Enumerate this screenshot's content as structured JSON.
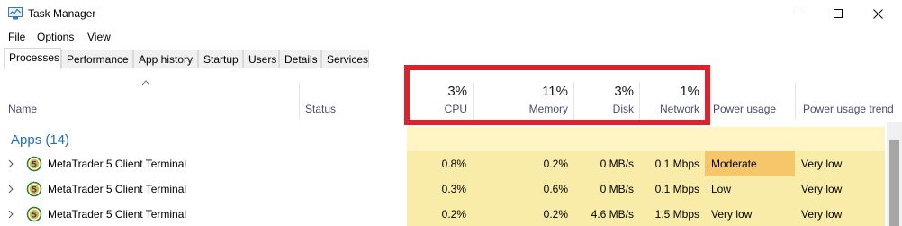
{
  "window": {
    "title": "Task Manager",
    "icon": "task-manager-icon"
  },
  "menu": [
    "File",
    "Options",
    "View"
  ],
  "tabs": [
    {
      "label": "Processes",
      "active": true
    },
    {
      "label": "Performance"
    },
    {
      "label": "App history"
    },
    {
      "label": "Startup"
    },
    {
      "label": "Users"
    },
    {
      "label": "Details"
    },
    {
      "label": "Services"
    }
  ],
  "columns": {
    "name": "Name",
    "status": "Status",
    "cpu": {
      "percent": "3%",
      "label": "CPU"
    },
    "memory": {
      "percent": "11%",
      "label": "Memory"
    },
    "disk": {
      "percent": "3%",
      "label": "Disk"
    },
    "network": {
      "percent": "1%",
      "label": "Network"
    },
    "power": "Power usage",
    "power_trend": "Power usage trend"
  },
  "groups": {
    "apps": "Apps (14)"
  },
  "rows": [
    {
      "name": "MetaTrader 5 Client Terminal",
      "cpu": "0.8%",
      "memory": "0.2%",
      "disk": "0 MB/s",
      "network": "0.1 Mbps",
      "power": "Moderate",
      "power_trend": "Very low"
    },
    {
      "name": "MetaTrader 5 Client Terminal",
      "cpu": "0.3%",
      "memory": "0.6%",
      "disk": "0 MB/s",
      "network": "0.1 Mbps",
      "power": "Low",
      "power_trend": "Very low"
    },
    {
      "name": "MetaTrader 5 Client Terminal",
      "cpu": "0.2%",
      "memory": "0.2%",
      "disk": "4.6 MB/s",
      "network": "1.5 Mbps",
      "power": "Very low",
      "power_trend": "Very low"
    }
  ],
  "colors": {
    "heat_light": "#fff4c4",
    "heat": "#f9eca8",
    "power_moderate": "#f5c66a",
    "highlight": "#e0202a",
    "group_title": "#1f6fc5"
  }
}
